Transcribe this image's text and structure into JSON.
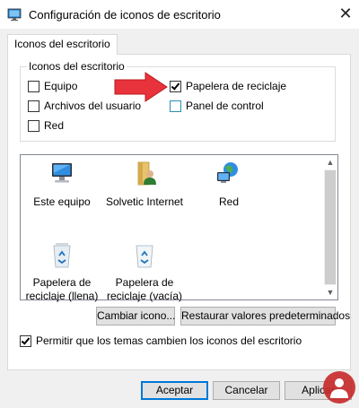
{
  "window": {
    "title": "Configuración de iconos de escritorio",
    "close_glyph": "✕"
  },
  "tab": {
    "label": "Iconos del escritorio"
  },
  "group": {
    "legend": "Iconos del escritorio",
    "checkboxes": [
      {
        "label": "Equipo",
        "checked": false
      },
      {
        "label": "Papelera de reciclaje",
        "checked": true
      },
      {
        "label": "Archivos del usuario",
        "checked": false
      },
      {
        "label": "Panel de control",
        "checked": false
      },
      {
        "label": "Red",
        "checked": false
      }
    ]
  },
  "annotation": {
    "arrow_color": "#e8323c"
  },
  "icons": [
    {
      "label": "Este equipo",
      "icon": "computer-icon"
    },
    {
      "label": "Solvetic Internet",
      "icon": "user-folder-icon"
    },
    {
      "label": "Red",
      "icon": "network-globe-icon"
    },
    {
      "label_line1": "Papelera de",
      "label_line2": "reciclaje (llena)",
      "icon": "recycle-bin-full-icon"
    },
    {
      "label_line1": "Papelera de",
      "label_line2": "reciclaje (vacía)",
      "icon": "recycle-bin-empty-icon"
    }
  ],
  "scrollbar": {
    "up_glyph": "▲",
    "down_glyph": "▼"
  },
  "buttons": {
    "change_icon": "Cambiar icono...",
    "restore_defaults": "Restaurar valores predeterminados",
    "ok": "Aceptar",
    "cancel": "Cancelar",
    "apply": "Aplicar"
  },
  "themes_checkbox": {
    "label": "Permitir que los temas cambien los iconos del escritorio",
    "checked": true
  },
  "colors": {
    "accent": "#0078d7",
    "watermark": "#c62828"
  }
}
